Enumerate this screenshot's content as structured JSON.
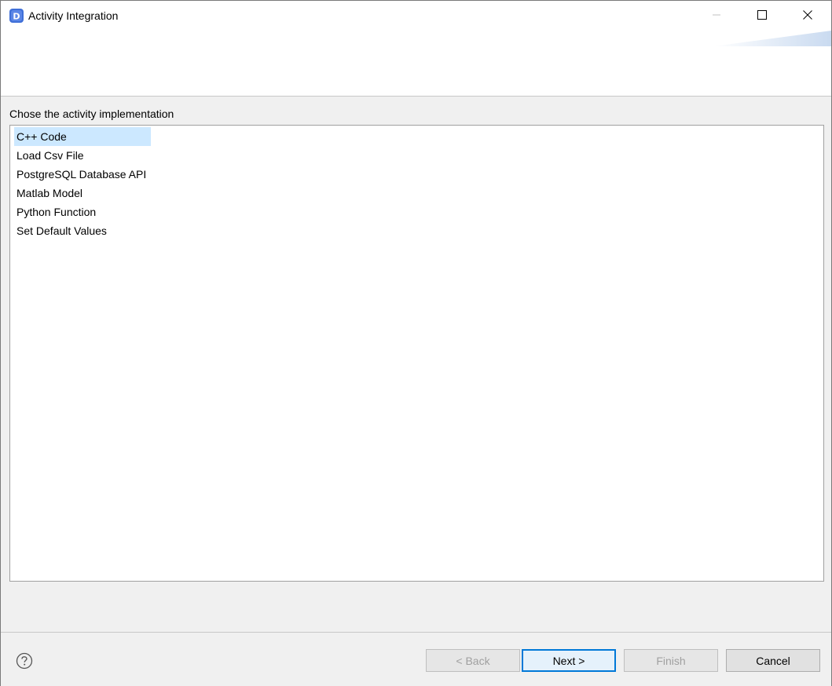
{
  "window": {
    "title": "Activity Integration",
    "icon": "app-d-icon",
    "controls": [
      "minimize-icon",
      "maximize-icon",
      "close-icon"
    ]
  },
  "page": {
    "prompt": "Chose the activity implementation"
  },
  "list": {
    "selected_index": 0,
    "items": [
      {
        "label": "C++ Code"
      },
      {
        "label": "Load Csv File"
      },
      {
        "label": "PostgreSQL Database API"
      },
      {
        "label": "Matlab Model"
      },
      {
        "label": "Python Function"
      },
      {
        "label": "Set Default Values"
      }
    ]
  },
  "footer": {
    "help_icon": "question-circle-icon",
    "back_label": "< Back",
    "next_label": "Next >",
    "finish_label": "Finish",
    "cancel_label": "Cancel"
  },
  "colors": {
    "selection": "#cce8ff",
    "accent": "#0078d7",
    "icon_blue": "#3f6fd8"
  }
}
